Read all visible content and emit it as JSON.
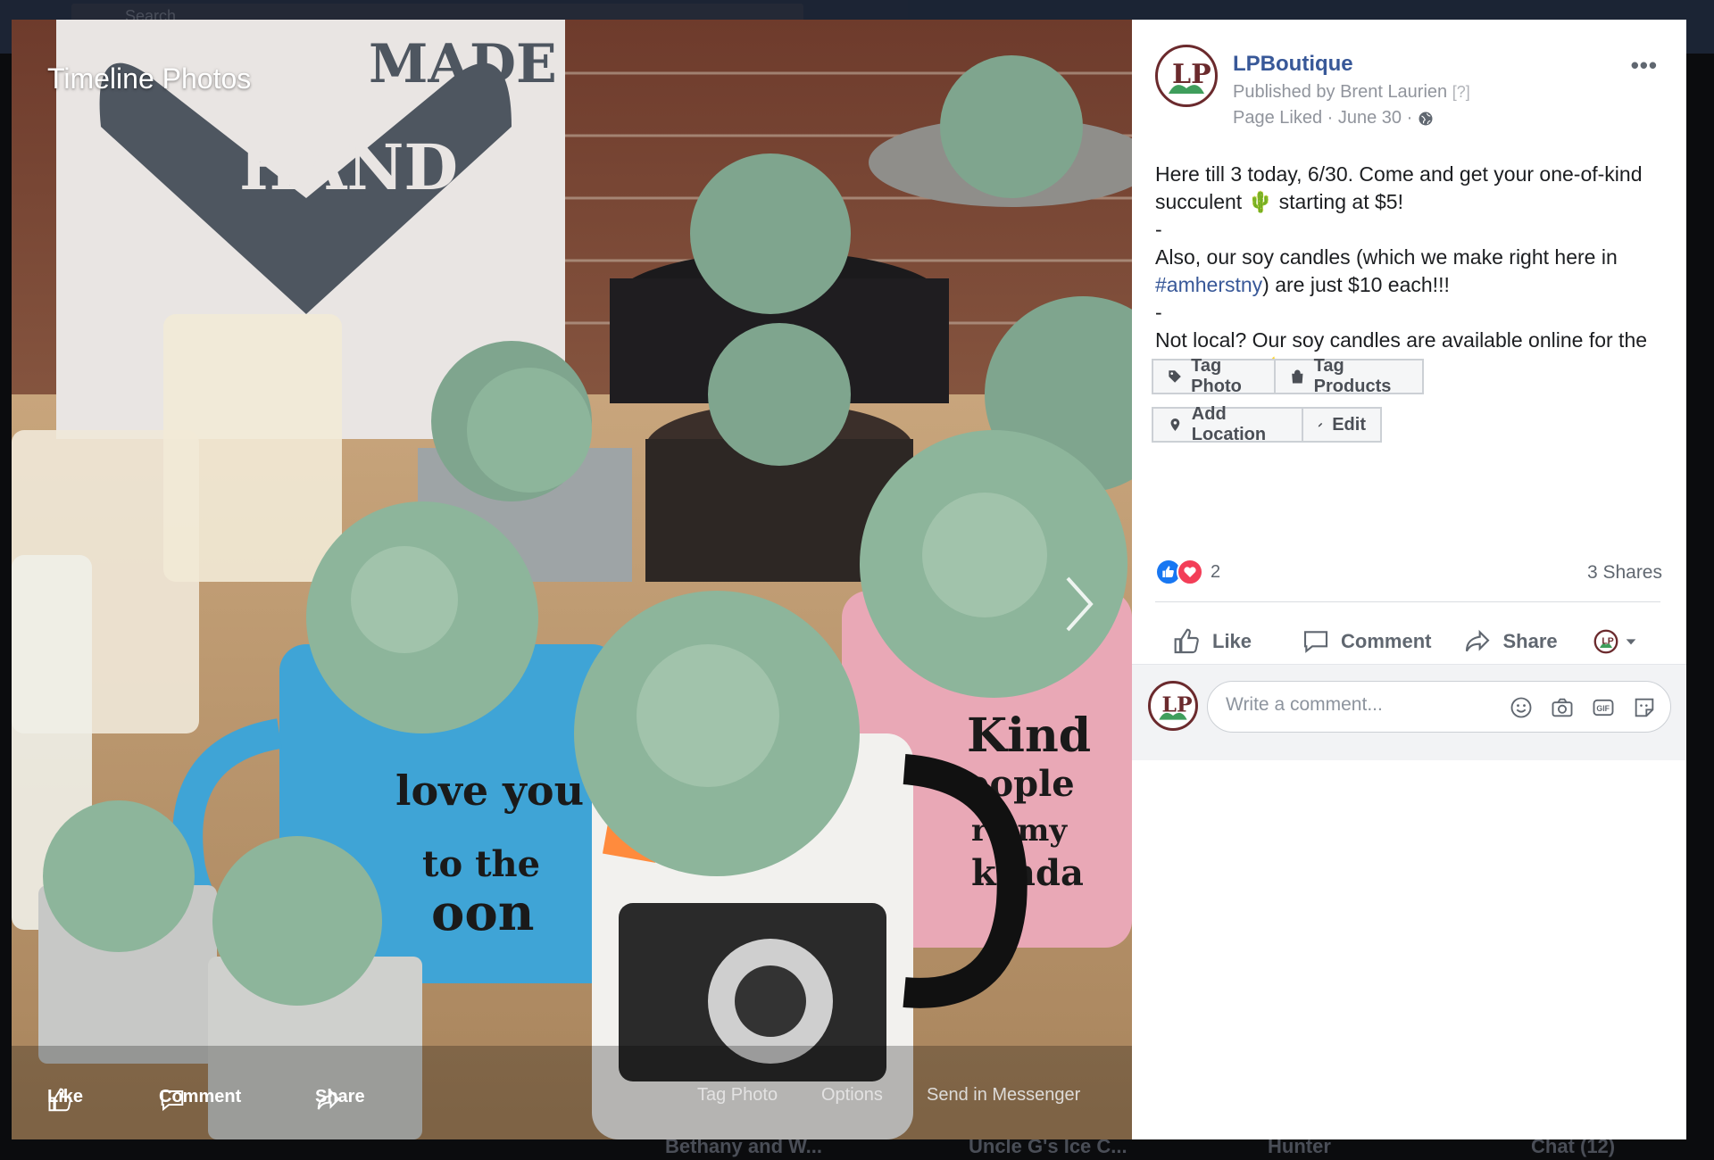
{
  "background": {
    "search_placeholder": "Search",
    "chat_items": [
      "Bethany and W...",
      "Uncle G's Ice C...",
      "Hunter",
      "Chat (12)"
    ]
  },
  "viewer": {
    "title": "Timeline Photos",
    "actions": {
      "like": "Like",
      "comment": "Comment",
      "share": "Share"
    },
    "links": {
      "tag_photo": "Tag Photo",
      "options": "Options",
      "send": "Send in Messenger"
    }
  },
  "post": {
    "page_name": "LPBoutique",
    "published_by": "Published by Brent Laurien",
    "published_help": "[?]",
    "meta": "Page Liked · June 30 ·",
    "text": {
      "line1_a": "Here till 3 today, 6/30. Come and get your one-of-kind succulent",
      "line1_emoji": "🌵",
      "line1_b": "starting at $5!",
      "dash1": "-",
      "line2_a": "Also, our soy candles (which we make right here in",
      "hashtag": "#amherstny",
      "line2_b": ") are just $10 each!!!",
      "dash2": "-",
      "line3": "Not local? Our soy candles are available online for the same price",
      "line3_emoji": "🕯️"
    },
    "buttons": {
      "tag_photo": "Tag Photo",
      "tag_products": "Tag Products",
      "add_location": "Add Location",
      "edit": "Edit"
    },
    "reaction_count": "2",
    "shares": "3 Shares",
    "actions": {
      "like": "Like",
      "comment": "Comment",
      "share": "Share"
    },
    "comment_placeholder": "Write a comment..."
  },
  "colors": {
    "link": "#385898",
    "like_blue": "#1877f2",
    "love_red": "#f33e58",
    "avatar_ring": "#6b2a2d"
  }
}
